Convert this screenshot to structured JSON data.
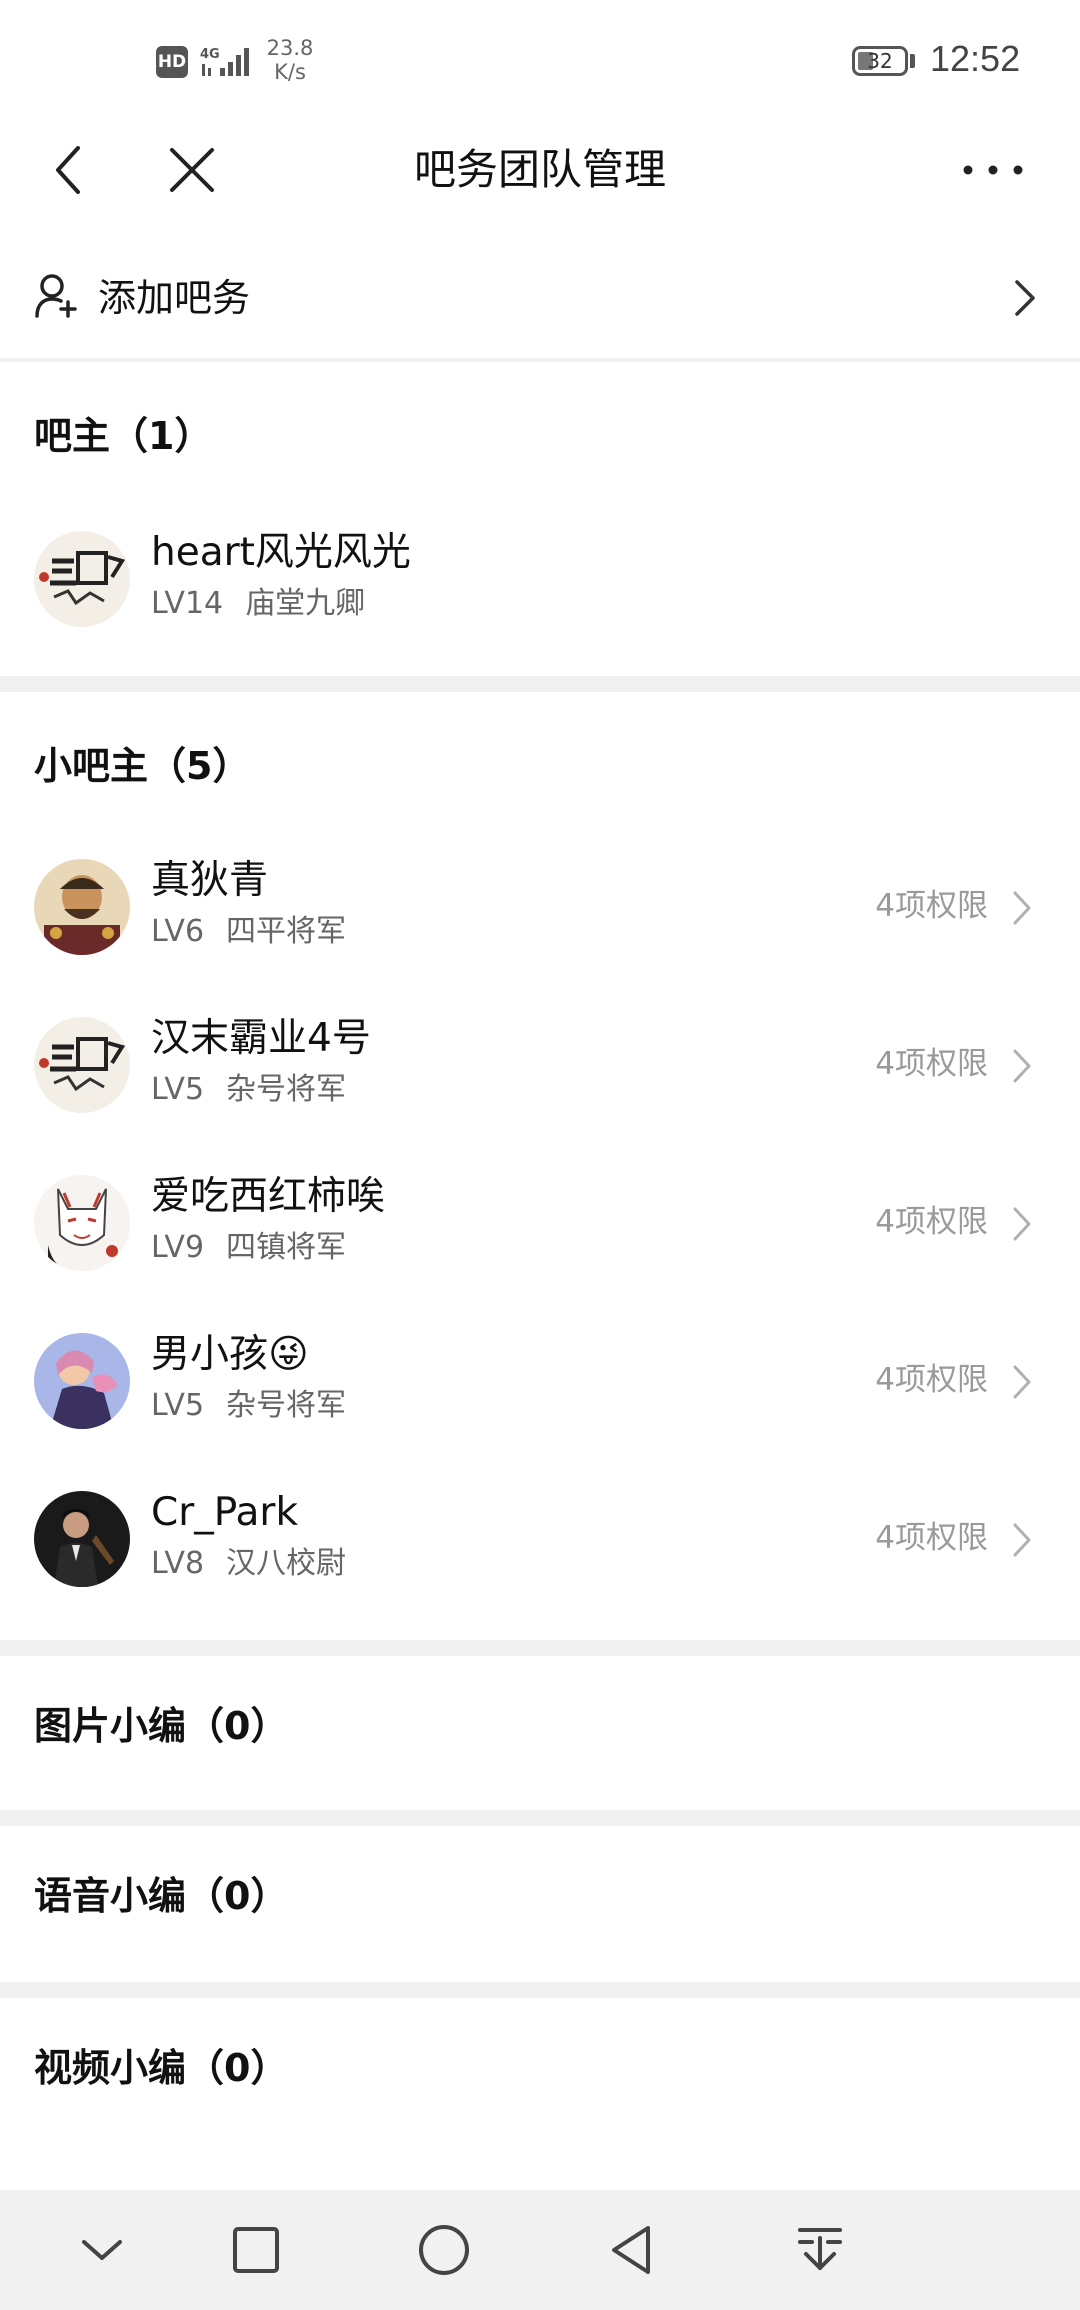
{
  "status_bar": {
    "hd_badge": "HD",
    "network": "4G",
    "speed_value": "23.8",
    "speed_unit": "K/s",
    "battery": "32",
    "time": "12:52"
  },
  "nav": {
    "title": "吧务团队管理"
  },
  "add_row": {
    "label": "添加吧务"
  },
  "sections": {
    "owner": {
      "title": "吧主（1）",
      "members": [
        {
          "name": "heart风光风光",
          "level": "LV14",
          "rank": "庙堂九卿"
        }
      ]
    },
    "sub_owner": {
      "title": "小吧主（5）",
      "members": [
        {
          "name": "真狄青",
          "level": "LV6",
          "rank": "四平将军",
          "permissions": "4项权限"
        },
        {
          "name": "汉末霸业4号",
          "level": "LV5",
          "rank": "杂号将军",
          "permissions": "4项权限"
        },
        {
          "name": "爱吃西红柿唉",
          "level": "LV9",
          "rank": "四镇将军",
          "permissions": "4项权限"
        },
        {
          "name": "男小孩😜",
          "level": "LV5",
          "rank": "杂号将军",
          "permissions": "4项权限"
        },
        {
          "name": "Cr_Park",
          "level": "LV8",
          "rank": "汉八校尉",
          "permissions": "4项权限"
        }
      ]
    },
    "image_editor": {
      "title": "图片小编（0）"
    },
    "voice_editor": {
      "title": "语音小编（0）"
    },
    "video_editor": {
      "title": "视频小编（0）"
    }
  },
  "colors": {
    "text_primary": "#111111",
    "text_secondary": "#666666",
    "text_muted": "#9a9a9a",
    "divider": "#f0f0f0"
  }
}
